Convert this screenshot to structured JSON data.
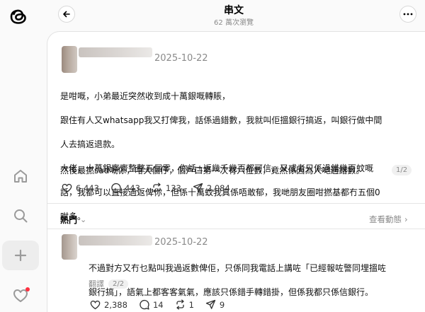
{
  "header": {
    "title": "串文",
    "views": "62 萬次瀏覽"
  },
  "sidebar": {
    "items": [
      {
        "icon": "threads-logo"
      },
      {
        "icon": "home-icon"
      },
      {
        "icon": "search-icon"
      },
      {
        "icon": "plus-icon"
      },
      {
        "icon": "heart-icon"
      }
    ],
    "notification_color": "#ff3040"
  },
  "post": {
    "date": "2025-10-22",
    "lines": [
      "是咁嘅，小弟最近突然收到成十萬銀嘅轉賬，",
      "跟住有人又whatsapp我又打俾我，話係過錯數，我就叫佢搵銀行搞返，叫銀行做中間",
      "人去搞返退款。",
      "大佬，十萬銀齊齊整整五個零，你話±返幾千幾百都可信，又或者只係過錯幾百蚊嘅",
      "話，我都可以直接過返俾你，但係十萬蚊我真係唔敢郁，我哋朋友圈咁撚基都冇五個0",
      "咁多。"
    ],
    "last_line": "然後最撚sad嘅係，咁大個仔，個戶口第一次有六位數，竟然係因為人哋過錯數。",
    "page_indicator": "1/2",
    "likes": "6,443",
    "comments": "443",
    "reposts": "133",
    "shares": "2,084"
  },
  "replies_section": {
    "sort_label": "熱門",
    "view_activity": "查看動態"
  },
  "reply": {
    "date": "2025-10-22",
    "lines": [
      "不過對方又冇乜點叫我過返數俾佢，只係同我電話上講咗「已經報咗警同埋搵咗",
      "銀行搞」，語氣上都客客氣氣，應該只係錯手轉錯掛，但係我都只係信銀行。"
    ],
    "translate_label": "翻譯",
    "page_indicator": "2/2",
    "likes": "2,388",
    "comments": "14",
    "reposts": "1",
    "shares": "9"
  }
}
